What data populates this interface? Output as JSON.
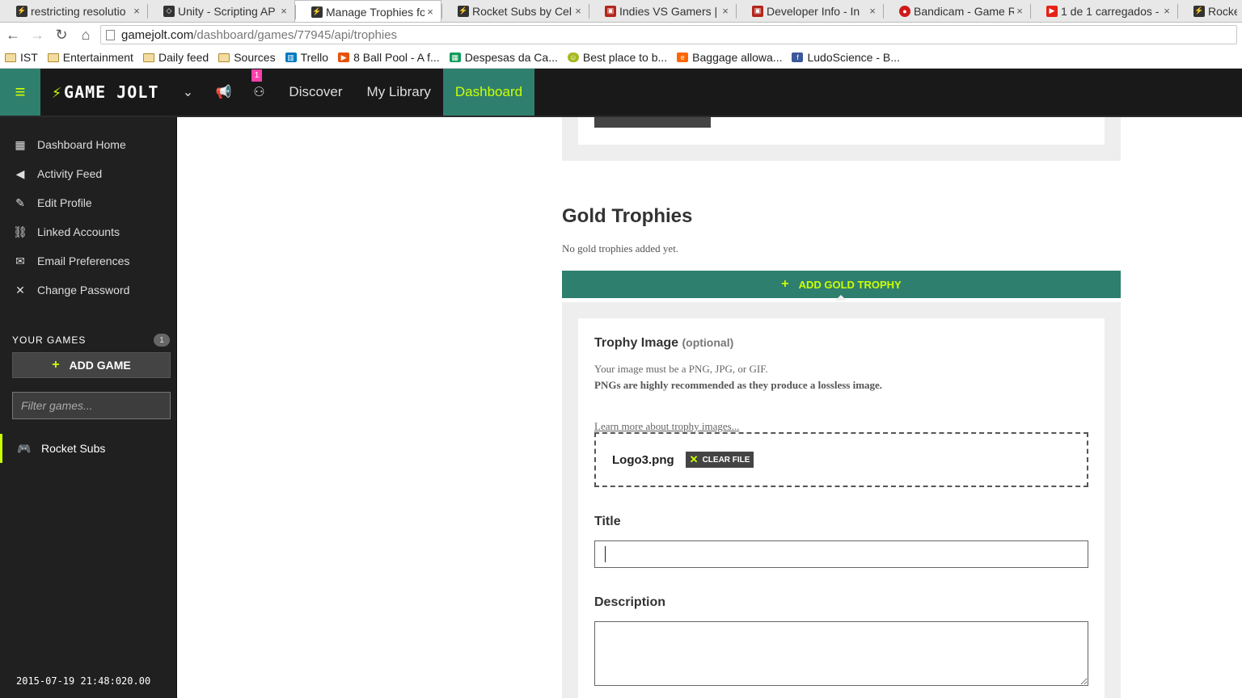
{
  "browser": {
    "tabs": [
      {
        "label": "restricting resolutio",
        "icon": "gamejolt-favicon-icon",
        "color": "#333333"
      },
      {
        "label": "Unity - Scripting AP",
        "icon": "unity-favicon-icon",
        "color": "#333333"
      },
      {
        "label": "Manage Trophies fo",
        "icon": "gamejolt-favicon-icon",
        "color": "#333333",
        "active": true
      },
      {
        "label": "Rocket Subs by Cel",
        "icon": "gamejolt-favicon-icon",
        "color": "#333333"
      },
      {
        "label": "Indies VS Gamers |",
        "icon": "indiedb-favicon-icon",
        "color": "#b3261e"
      },
      {
        "label": "Developer Info - In",
        "icon": "indiedb-favicon-icon",
        "color": "#b3261e"
      },
      {
        "label": "Bandicam - Game R",
        "icon": "bandicam-favicon-icon",
        "color": "#d01a1a"
      },
      {
        "label": "1 de 1 carregados -",
        "icon": "youtube-favicon-icon",
        "color": "#e62117"
      },
      {
        "label": "Rocket",
        "icon": "gamejolt-favicon-icon",
        "color": "#333333"
      }
    ],
    "url_host": "gamejolt.com",
    "url_path": "/dashboard/games/77945/api/trophies",
    "bookmarks": [
      {
        "label": "IST",
        "icon": "folder-icon"
      },
      {
        "label": "Entertainment",
        "icon": "folder-icon"
      },
      {
        "label": "Daily feed",
        "icon": "folder-icon"
      },
      {
        "label": "Sources",
        "icon": "folder-icon"
      },
      {
        "label": "Trello",
        "icon": "trello-icon",
        "color": "#0079bf"
      },
      {
        "label": "8 Ball Pool - A f...",
        "icon": "play-icon",
        "color": "#e8500a"
      },
      {
        "label": "Despesas da Ca...",
        "icon": "sheets-icon",
        "color": "#0f9d58"
      },
      {
        "label": "Best place to b...",
        "icon": "smiley-icon",
        "color": "#a6b820"
      },
      {
        "label": "Baggage allowa...",
        "icon": "easyjet-icon",
        "color": "#ff6600"
      },
      {
        "label": "LudoScience - B...",
        "icon": "facebook-icon",
        "color": "#3b5998"
      }
    ]
  },
  "header": {
    "logo": "GAME JOLT",
    "notification_count": "1",
    "nav": [
      {
        "label": "Discover"
      },
      {
        "label": "My Library"
      },
      {
        "label": "Dashboard",
        "active": true
      }
    ],
    "accent": "#ccff00",
    "brand_green": "#2f7f6f"
  },
  "sidebar": {
    "items": [
      {
        "label": "Dashboard Home",
        "icon": "dashboard-icon"
      },
      {
        "label": "Activity Feed",
        "icon": "megaphone-icon"
      },
      {
        "label": "Edit Profile",
        "icon": "pencil-icon"
      },
      {
        "label": "Linked Accounts",
        "icon": "link-icon"
      },
      {
        "label": "Email Preferences",
        "icon": "envelope-icon"
      },
      {
        "label": "Change Password",
        "icon": "tools-icon"
      }
    ],
    "your_games_label": "YOUR GAMES",
    "games_count": "1",
    "add_game_label": "ADD GAME",
    "filter_placeholder": "Filter games...",
    "games": [
      {
        "label": "Rocket Subs",
        "icon": "gamepad-icon"
      }
    ],
    "timestamp": "2015-07-19 21:48:020.00"
  },
  "main": {
    "section_title": "Gold Trophies",
    "empty_message": "No gold trophies added yet.",
    "add_button_label": "ADD GOLD TROPHY",
    "form": {
      "image_label": "Trophy Image",
      "image_optional": "(optional)",
      "image_help_1": "Your image must be a PNG, JPG, or GIF.",
      "image_help_2": "PNGs are highly recommended as they produce a lossless image.",
      "learn_more": "Learn more about trophy images...",
      "file_name": "Logo3.png",
      "clear_file_label": "CLEAR FILE",
      "title_label": "Title",
      "title_value": "",
      "description_label": "Description",
      "description_value": ""
    }
  }
}
